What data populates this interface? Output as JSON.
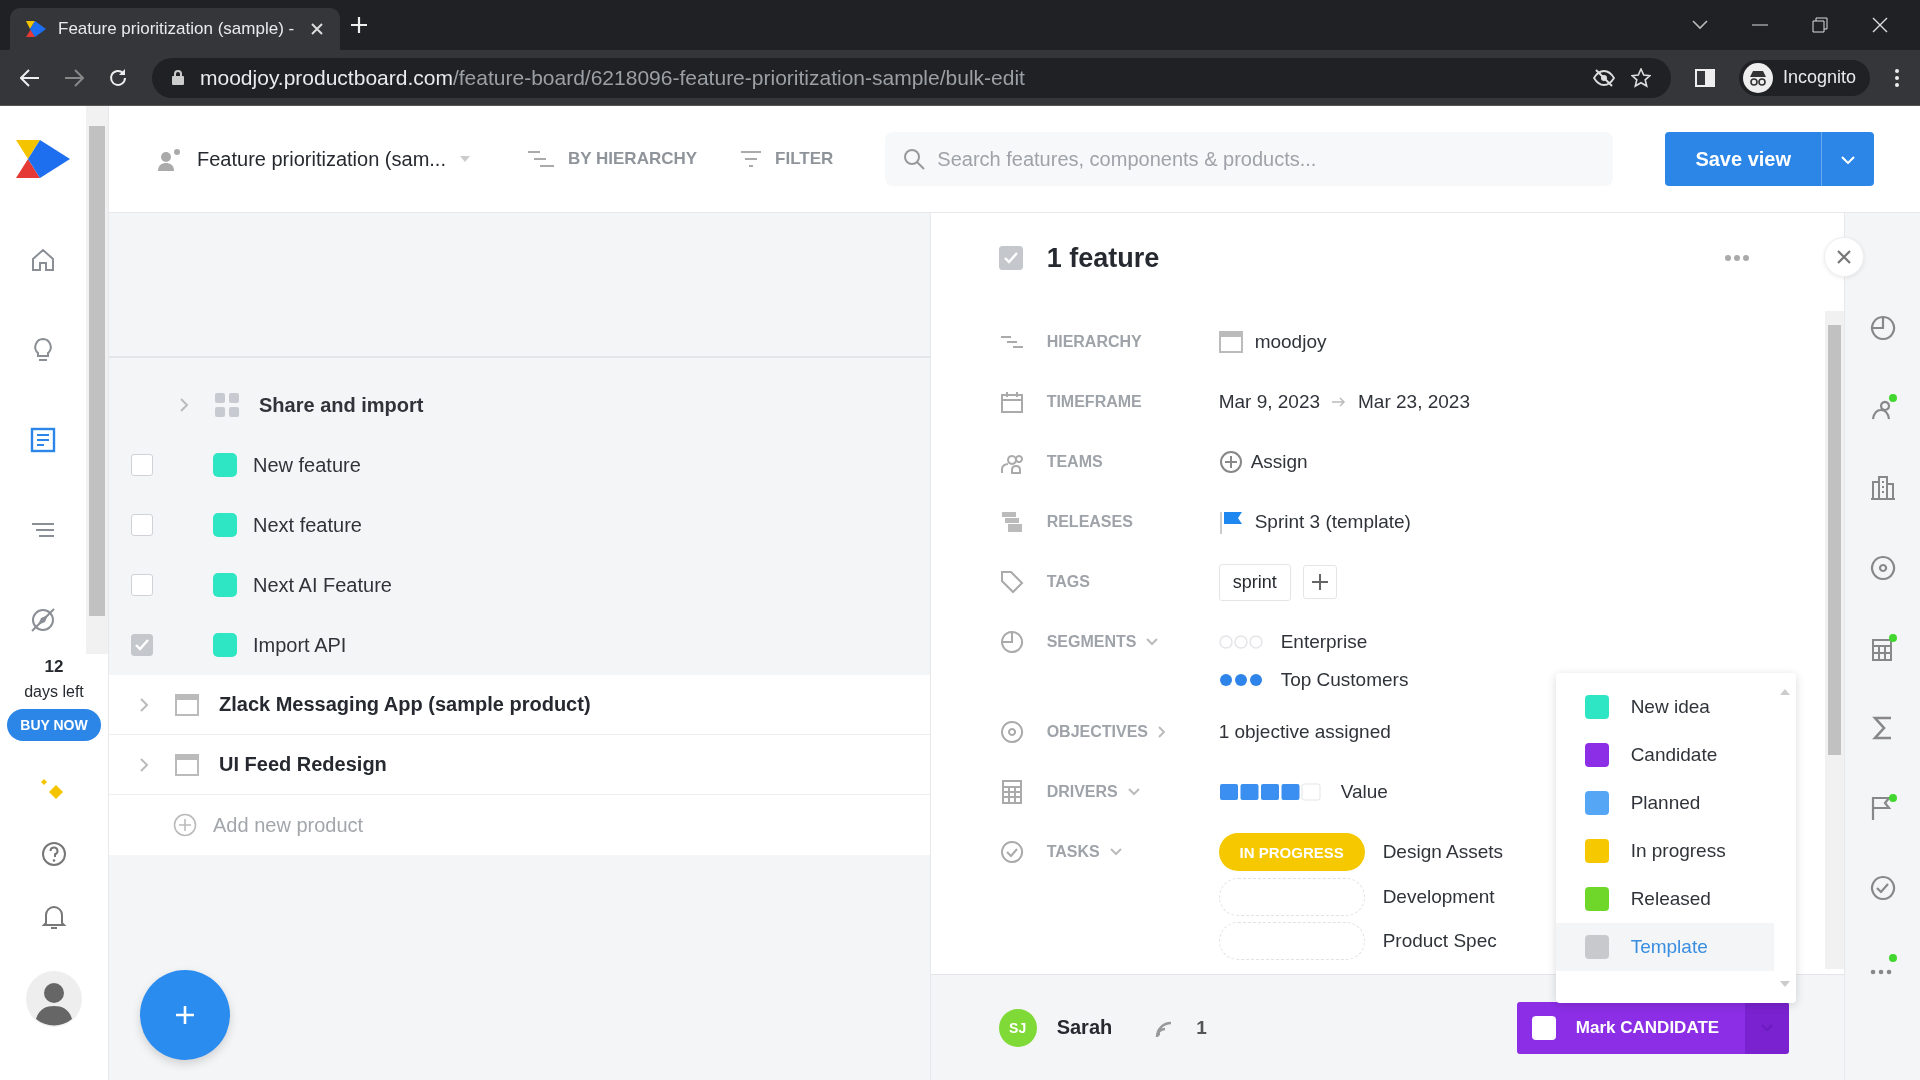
{
  "browser": {
    "tab_title": "Feature prioritization (sample) - ",
    "url_host": "moodjoy.productboard.com",
    "url_path": "/feature-board/6218096-feature-prioritization-sample/bulk-edit",
    "profile": "Incognito"
  },
  "sidebar": {
    "nav_items": [
      {
        "kind": "home",
        "selected": false
      },
      {
        "kind": "bulb",
        "selected": false
      },
      {
        "kind": "board",
        "selected": true
      },
      {
        "kind": "lines",
        "selected": false
      },
      {
        "kind": "compass",
        "selected": false
      }
    ],
    "trial_days": "12",
    "trial_label": "days left",
    "buy_label": "BUY NOW"
  },
  "header": {
    "board_title": "Feature prioritization (sam...",
    "grouping": "BY HIERARCHY",
    "filter": "FILTER",
    "search_placeholder": "Search features, components & products...",
    "save_label": "Save view"
  },
  "tree": [
    {
      "kind": "component",
      "name": "Share and import",
      "children": [
        {
          "kind": "feature",
          "name": "New feature",
          "checked": false
        },
        {
          "kind": "feature",
          "name": "Next feature",
          "checked": false
        },
        {
          "kind": "feature",
          "name": "Next AI Feature",
          "checked": false
        },
        {
          "kind": "feature",
          "name": "Import API",
          "checked": true
        }
      ]
    },
    {
      "kind": "product",
      "name": "Zlack Messaging App (sample product)"
    },
    {
      "kind": "product",
      "name": "UI Feed Redesign"
    }
  ],
  "add_product": "Add new product",
  "detail": {
    "title": "1 feature",
    "checked": true,
    "fields": [
      {
        "kind": "hierarchy",
        "label": "HIERARCHY",
        "value": "moodjoy"
      },
      {
        "kind": "timeframe",
        "label": "TIMEFRAME",
        "start": "Mar 9, 2023",
        "end": "Mar 23, 2023"
      },
      {
        "kind": "teams",
        "label": "TEAMS",
        "value": "Assign"
      },
      {
        "kind": "releases",
        "label": "RELEASES",
        "value": "Sprint 3 (template)"
      },
      {
        "kind": "tags",
        "label": "TAGS",
        "tags": [
          "sprint"
        ]
      },
      {
        "kind": "segments",
        "label": "SEGMENTS",
        "items": [
          {
            "name": "Enterprise",
            "stars": 0
          },
          {
            "name": "Top Customers",
            "stars": 3
          }
        ]
      },
      {
        "kind": "objectives",
        "label": "OBJECTIVES",
        "value": "1 objective assigned"
      },
      {
        "kind": "drivers",
        "label": "DRIVERS",
        "items": [
          {
            "name": "Value",
            "stars": 4
          }
        ]
      },
      {
        "kind": "tasks",
        "label": "TASKS",
        "items": [
          {
            "name": "Design Assets",
            "status": "IN PROGRESS"
          },
          {
            "name": "Development"
          },
          {
            "name": "Product Spec"
          }
        ]
      }
    ]
  },
  "status_menu": [
    {
      "name": "New idea",
      "color": "#2ee6c3",
      "hovered": false
    },
    {
      "name": "Candidate",
      "color": "#8c2ee6",
      "hovered": false
    },
    {
      "name": "Planned",
      "color": "#55a6f5",
      "hovered": false
    },
    {
      "name": "In progress",
      "color": "#f5c800",
      "hovered": false
    },
    {
      "name": "Released",
      "color": "#6fd62a",
      "hovered": false
    },
    {
      "name": "Template",
      "color": "#c8c9cc",
      "hovered": true
    }
  ],
  "footer": {
    "initials": "SJ",
    "user": "Sarah",
    "count": "1",
    "action": "Mark CANDIDATE"
  },
  "rail": [
    {
      "kind": "pie",
      "notify": false
    },
    {
      "kind": "person",
      "notify": true
    },
    {
      "kind": "building",
      "notify": false
    },
    {
      "kind": "target",
      "notify": false
    },
    {
      "kind": "calc",
      "notify": true
    },
    {
      "kind": "sigma",
      "notify": false
    },
    {
      "kind": "flag",
      "notify": true
    },
    {
      "kind": "check",
      "notify": false
    },
    {
      "kind": "dots",
      "notify": true
    }
  ]
}
